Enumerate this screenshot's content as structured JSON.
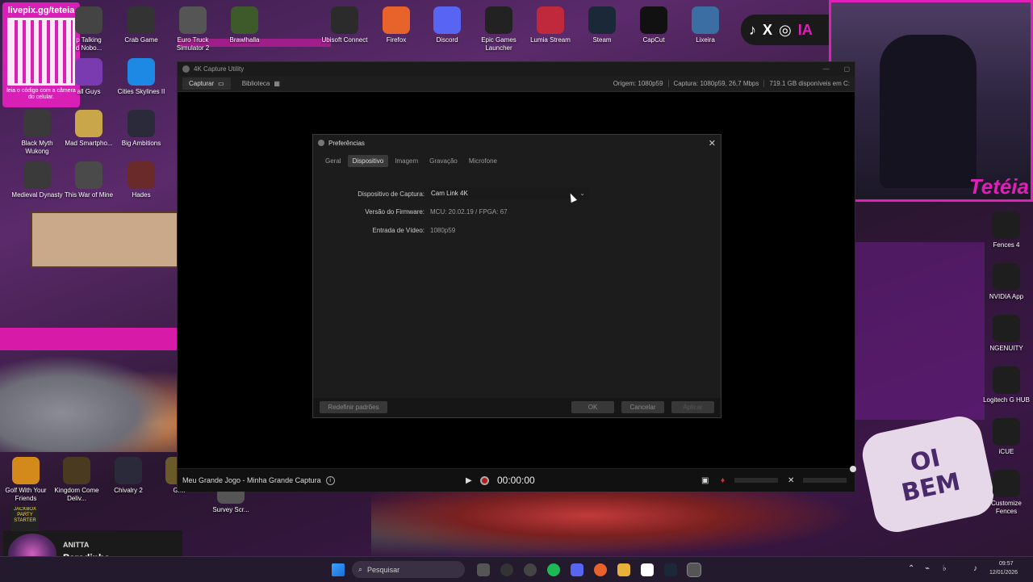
{
  "desktop": {
    "livepix": {
      "url": "livepix.gg/teteia",
      "caption": "leia o código com a câmera do celular."
    },
    "top_icons": [
      {
        "label": "Ubisoft Connect",
        "color": "#2b2b2b"
      },
      {
        "label": "Firefox",
        "color": "#e8622c"
      },
      {
        "label": "Discord",
        "color": "#5865f2"
      },
      {
        "label": "Epic Games Launcher",
        "color": "#222222"
      },
      {
        "label": "Lumia Stream",
        "color": "#c0283c"
      },
      {
        "label": "Steam",
        "color": "#1b2838"
      },
      {
        "label": "CapCut",
        "color": "#111111"
      },
      {
        "label": "Lixeira",
        "color": "#3b6fa3"
      }
    ],
    "left_icons": [
      {
        "label": "p Talking\nd Nobo...",
        "color": "#444"
      },
      {
        "label": "Crab Game",
        "color": "#333"
      },
      {
        "label": "Euro Truck Simulator 2",
        "color": "#555"
      },
      {
        "label": "Brawlhalla",
        "color": "#3e5a2b"
      },
      {
        "label": "all Guys",
        "color": "#7a3ab0"
      },
      {
        "label": "Cities Skylines II",
        "color": "#1e88e5"
      },
      {
        "label": "Black Myth Wukong",
        "color": "#3a3a3a"
      },
      {
        "label": "Mad Smartpho...",
        "color": "#c9a64a"
      },
      {
        "label": "Big Ambitions",
        "color": "#2a2a3a"
      },
      {
        "label": "Medieval Dynasty",
        "color": "#3a3a3a"
      },
      {
        "label": "This War of Mine",
        "color": "#4a4a4a"
      },
      {
        "label": "Hades",
        "color": "#6a2a2a"
      },
      {
        "label": "Golf With Your Friends",
        "color": "#d48a1a"
      },
      {
        "label": "Kingdom Come Deliv...",
        "color": "#4a3a20"
      },
      {
        "label": "Chivalry 2",
        "color": "#2a2a3a"
      },
      {
        "label": "Gr...",
        "color": "#6a5a2a"
      },
      {
        "label": "Survey Scr...",
        "color": "#555"
      }
    ],
    "right_icons": [
      {
        "label": "Fences 4",
        "color": "#1e1e1e"
      },
      {
        "label": "NVIDIA App",
        "color": "#1e1e1e"
      },
      {
        "label": "NGENUITY",
        "color": "#1e1e1e"
      },
      {
        "label": "Logitech G HUB",
        "color": "#1e1e1e"
      },
      {
        "label": "iCUE",
        "color": "#1e1e1e"
      },
      {
        "label": "Customize Fences",
        "color": "#1e1e1e"
      }
    ],
    "webcam_name": "Tetéia",
    "sticker_text": "OI BEM",
    "social_handle_fragment": "IA",
    "music": {
      "artist": "ANITTA",
      "title": "Paradinha"
    },
    "jackbox": "JACKBOX PARTY STARTER"
  },
  "app": {
    "title": "4K Capture Utility",
    "tabs": [
      {
        "label": "Capturar",
        "active": true
      },
      {
        "label": "Biblioteca",
        "active": false
      }
    ],
    "status": {
      "origin": "Origem: 1080p59",
      "capture": "Captura: 1080p59, 26,7 Mbps",
      "disk": "719.1 GB disponíveis em C:"
    },
    "bottom": {
      "capture_name": "Meu Grande Jogo - Minha Grande Captura",
      "timer": "00:00:00"
    }
  },
  "dialog": {
    "title": "Preferências",
    "tabs": [
      {
        "label": "Geral",
        "active": false
      },
      {
        "label": "Dispositivo",
        "active": true
      },
      {
        "label": "Imagem",
        "active": false
      },
      {
        "label": "Gravação",
        "active": false
      },
      {
        "label": "Microfone",
        "active": false
      }
    ],
    "fields": {
      "device_label": "Dispositivo de Captura:",
      "device_value": "Cam Link 4K",
      "firmware_label": "Versão do Firmware:",
      "firmware_value": "MCU: 20.02.19 / FPGA: 67",
      "input_label": "Entrada de Vídeo:",
      "input_value": "1080p59"
    },
    "buttons": {
      "reset": "Redefinir padrões",
      "ok": "OK",
      "cancel": "Cancelar",
      "apply": "Aplicar"
    }
  },
  "taskbar": {
    "search_placeholder": "Pesquisar",
    "time": "09:57",
    "date": "12/01/2026"
  }
}
